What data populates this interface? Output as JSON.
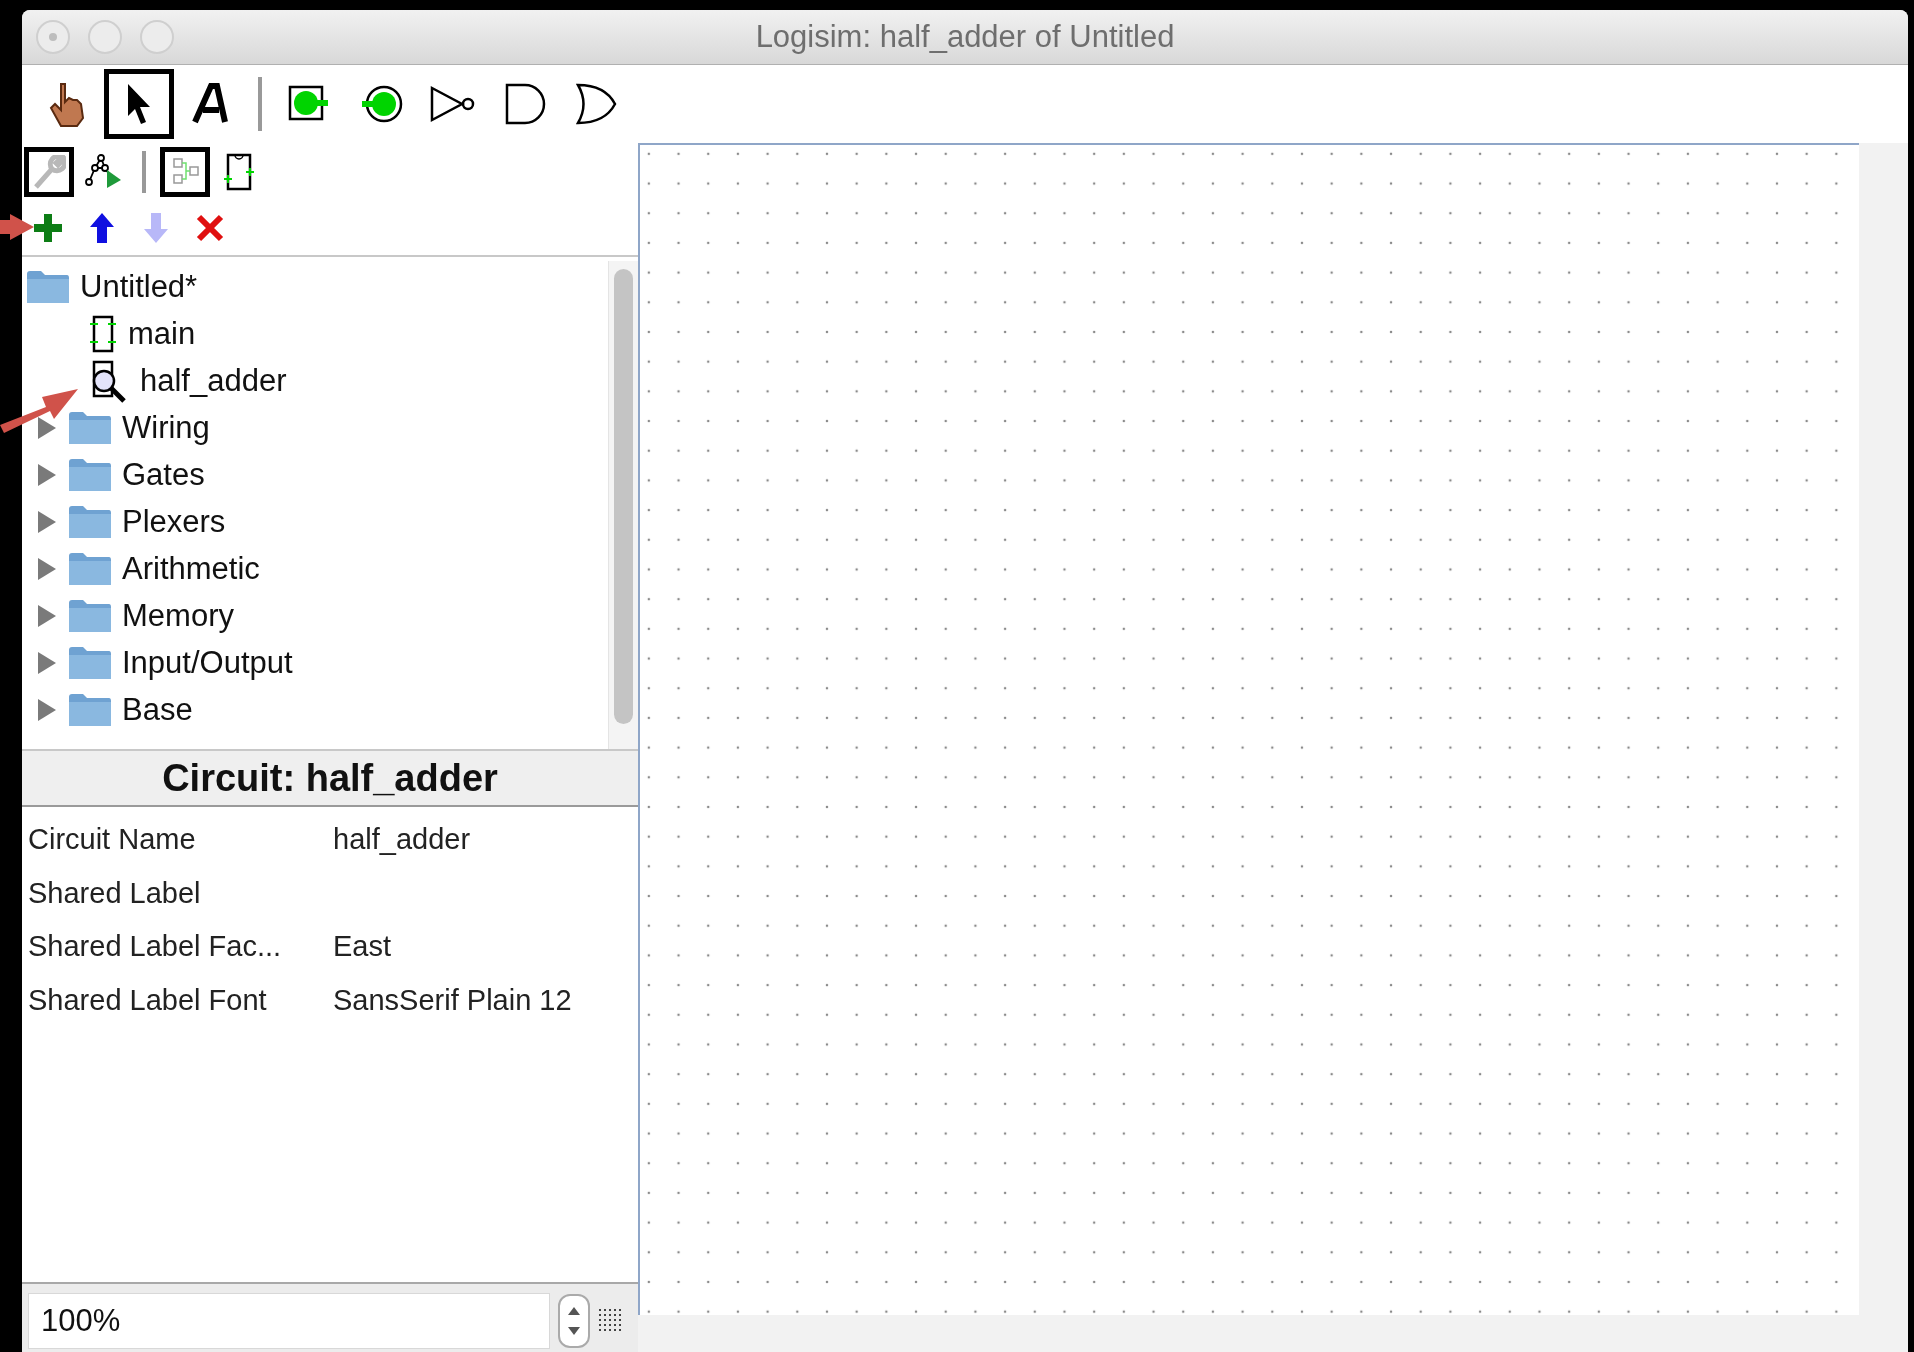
{
  "window": {
    "title": "Logisim: half_adder of Untitled"
  },
  "toolbar": [
    {
      "kind": "poke",
      "selected": false
    },
    {
      "kind": "select",
      "selected": true
    },
    {
      "kind": "text",
      "selected": false
    },
    {
      "kind": "separator"
    },
    {
      "kind": "input",
      "selected": false
    },
    {
      "kind": "output",
      "selected": false
    },
    {
      "kind": "not",
      "selected": false
    },
    {
      "kind": "and",
      "selected": false
    },
    {
      "kind": "or",
      "selected": false
    }
  ],
  "project_toolbar": [
    {
      "kind": "wrench",
      "selected": true
    },
    {
      "kind": "simulate",
      "selected": false
    },
    {
      "kind": "separator"
    },
    {
      "kind": "layout",
      "selected": true
    },
    {
      "kind": "appearance",
      "selected": false
    }
  ],
  "explorer_actions": [
    {
      "kind": "add",
      "disabled": false
    },
    {
      "kind": "up",
      "disabled": false
    },
    {
      "kind": "down",
      "disabled": true
    },
    {
      "kind": "delete",
      "disabled": false
    }
  ],
  "tree": [
    {
      "label": "Untitled*",
      "kind": "project",
      "children": [
        {
          "label": "main",
          "kind": "circuit"
        },
        {
          "label": "half_adder",
          "kind": "circuit-view"
        }
      ]
    },
    {
      "label": "Wiring",
      "kind": "library",
      "expanded": false
    },
    {
      "label": "Gates",
      "kind": "library",
      "expanded": false
    },
    {
      "label": "Plexers",
      "kind": "library",
      "expanded": false
    },
    {
      "label": "Arithmetic",
      "kind": "library",
      "expanded": false
    },
    {
      "label": "Memory",
      "kind": "library",
      "expanded": false
    },
    {
      "label": "Input/Output",
      "kind": "library",
      "expanded": false
    },
    {
      "label": "Base",
      "kind": "library",
      "expanded": false
    }
  ],
  "attributes": {
    "title": "Circuit: half_adder",
    "rows": [
      {
        "name": "Circuit Name",
        "value": "half_adder"
      },
      {
        "name": "Shared Label"
      },
      {
        "name": "Shared Label Fac...",
        "value": "East"
      },
      {
        "name": "Shared Label Font",
        "value": "SansSerif Plain 12"
      }
    ]
  },
  "zoom": {
    "value": "100%"
  }
}
